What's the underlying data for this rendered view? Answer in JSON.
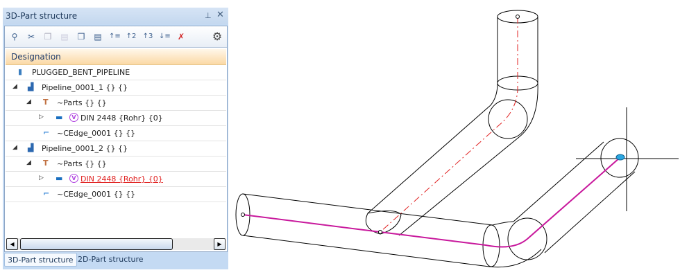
{
  "panel": {
    "title": "3D-Part structure",
    "pin_icon": "pin-icon",
    "close_icon": "close-icon",
    "toolbar": [
      "find-icon",
      "cut-icon",
      "copy-icon",
      "paste-icon",
      "copy-special-icon",
      "paste-special-icon",
      "expand-level-1-icon",
      "expand-level-2-icon",
      "expand-level-3-icon",
      "expand-all-icon",
      "clear-sort-icon",
      "settings-icon"
    ],
    "column_header": "Designation",
    "tree": [
      {
        "label": "PLUGGED_BENT_PIPELINE",
        "level": 0,
        "expander": "",
        "icon": "assembly-icon"
      },
      {
        "label": "Pipeline_0001_1 {} {}",
        "level": 1,
        "expander": "◢",
        "icon": "pipeline-icon"
      },
      {
        "label": "~Parts {} {}",
        "level": 2,
        "expander": "◢",
        "icon": "parts-icon"
      },
      {
        "label": "DIN 2448 {Rohr} {0}",
        "level": 3,
        "expander": "▷",
        "icon": "pipe-icon",
        "badge": "V"
      },
      {
        "label": "~CEdge_0001 {} {}",
        "level": 2,
        "expander": "",
        "icon": "edge-icon"
      },
      {
        "label": "Pipeline_0001_2 {} {}",
        "level": 1,
        "expander": "◢",
        "icon": "pipeline-icon"
      },
      {
        "label": "~Parts {} {}",
        "level": 2,
        "expander": "◢",
        "icon": "parts-icon"
      },
      {
        "label": "DIN 2448 {Rohr} {0}",
        "level": 3,
        "expander": "▷",
        "icon": "pipe-icon",
        "badge": "V",
        "highlight": true
      },
      {
        "label": "~CEdge_0001 {} {}",
        "level": 2,
        "expander": "",
        "icon": "edge-icon"
      }
    ],
    "tabs": [
      "3D-Part structure",
      "2D-Part structure"
    ]
  },
  "colors": {
    "pipe_path": "#c8189c",
    "centerline": "#e02020",
    "accent": "#c4daf3"
  }
}
